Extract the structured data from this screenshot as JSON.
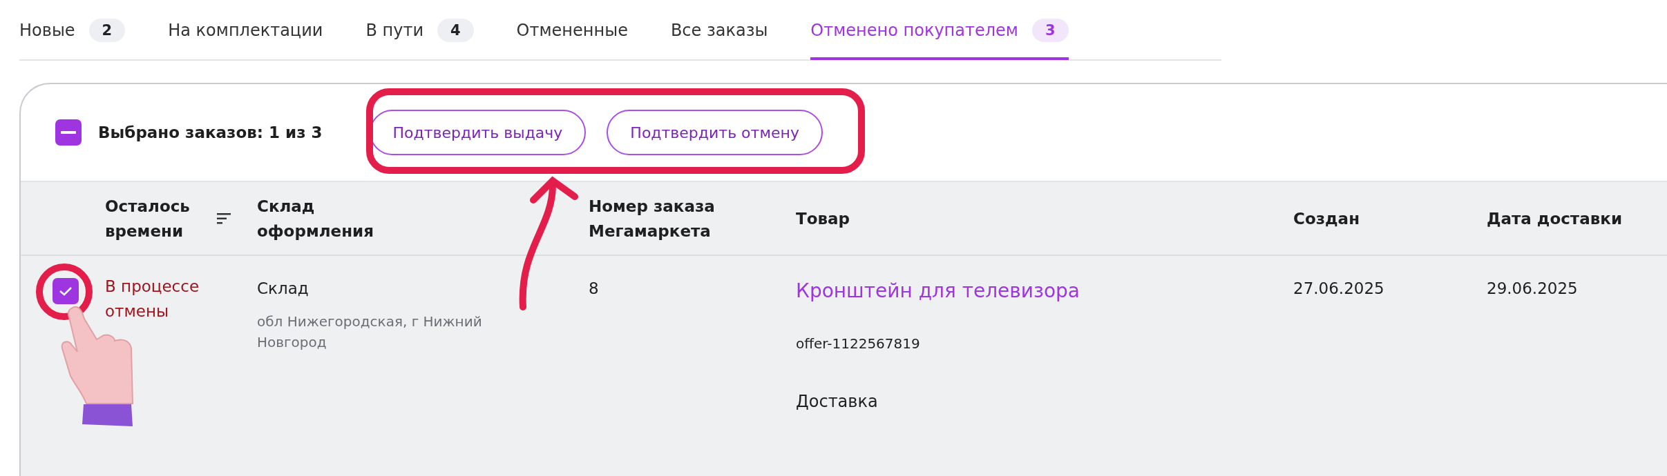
{
  "tabs": [
    {
      "label": "Новые",
      "count": "2",
      "selected": false
    },
    {
      "label": "На комплектации",
      "selected": false
    },
    {
      "label": "В пути",
      "count": "4",
      "selected": false
    },
    {
      "label": "Отмененные",
      "selected": false
    },
    {
      "label": "Все заказы",
      "selected": false
    },
    {
      "label": "Отменено покупателем",
      "count": "3",
      "selected": true
    }
  ],
  "selection": {
    "indeterminate": true,
    "text": "Выбрано заказов: 1 из 3"
  },
  "buttons": [
    "Подтвердить выдачу",
    "Подтвердить отмену"
  ],
  "table": {
    "columns": [
      {
        "label": "Осталось времени",
        "sortable": true
      },
      {
        "label": "Склад оформления",
        "sortable": false
      },
      {
        "label": "Номер заказа Мегамаркета",
        "sortable": false
      },
      {
        "label": "Товар",
        "sortable": false
      },
      {
        "label": "Создан",
        "sortable": false
      },
      {
        "label": "Дата доставки",
        "sortable": false
      }
    ],
    "rows": [
      {
        "checked": true,
        "status": "В процессе отмены",
        "warehouse": "Склад",
        "address": "обл Нижегородская, г Нижний Новгород",
        "order_number": "8",
        "product": "Кронштейн для телевизора",
        "offer": "offer-1122567819",
        "delivery": "Доставка",
        "created": "27.06.2025",
        "delivery_date": "29.06.2025"
      }
    ]
  }
}
